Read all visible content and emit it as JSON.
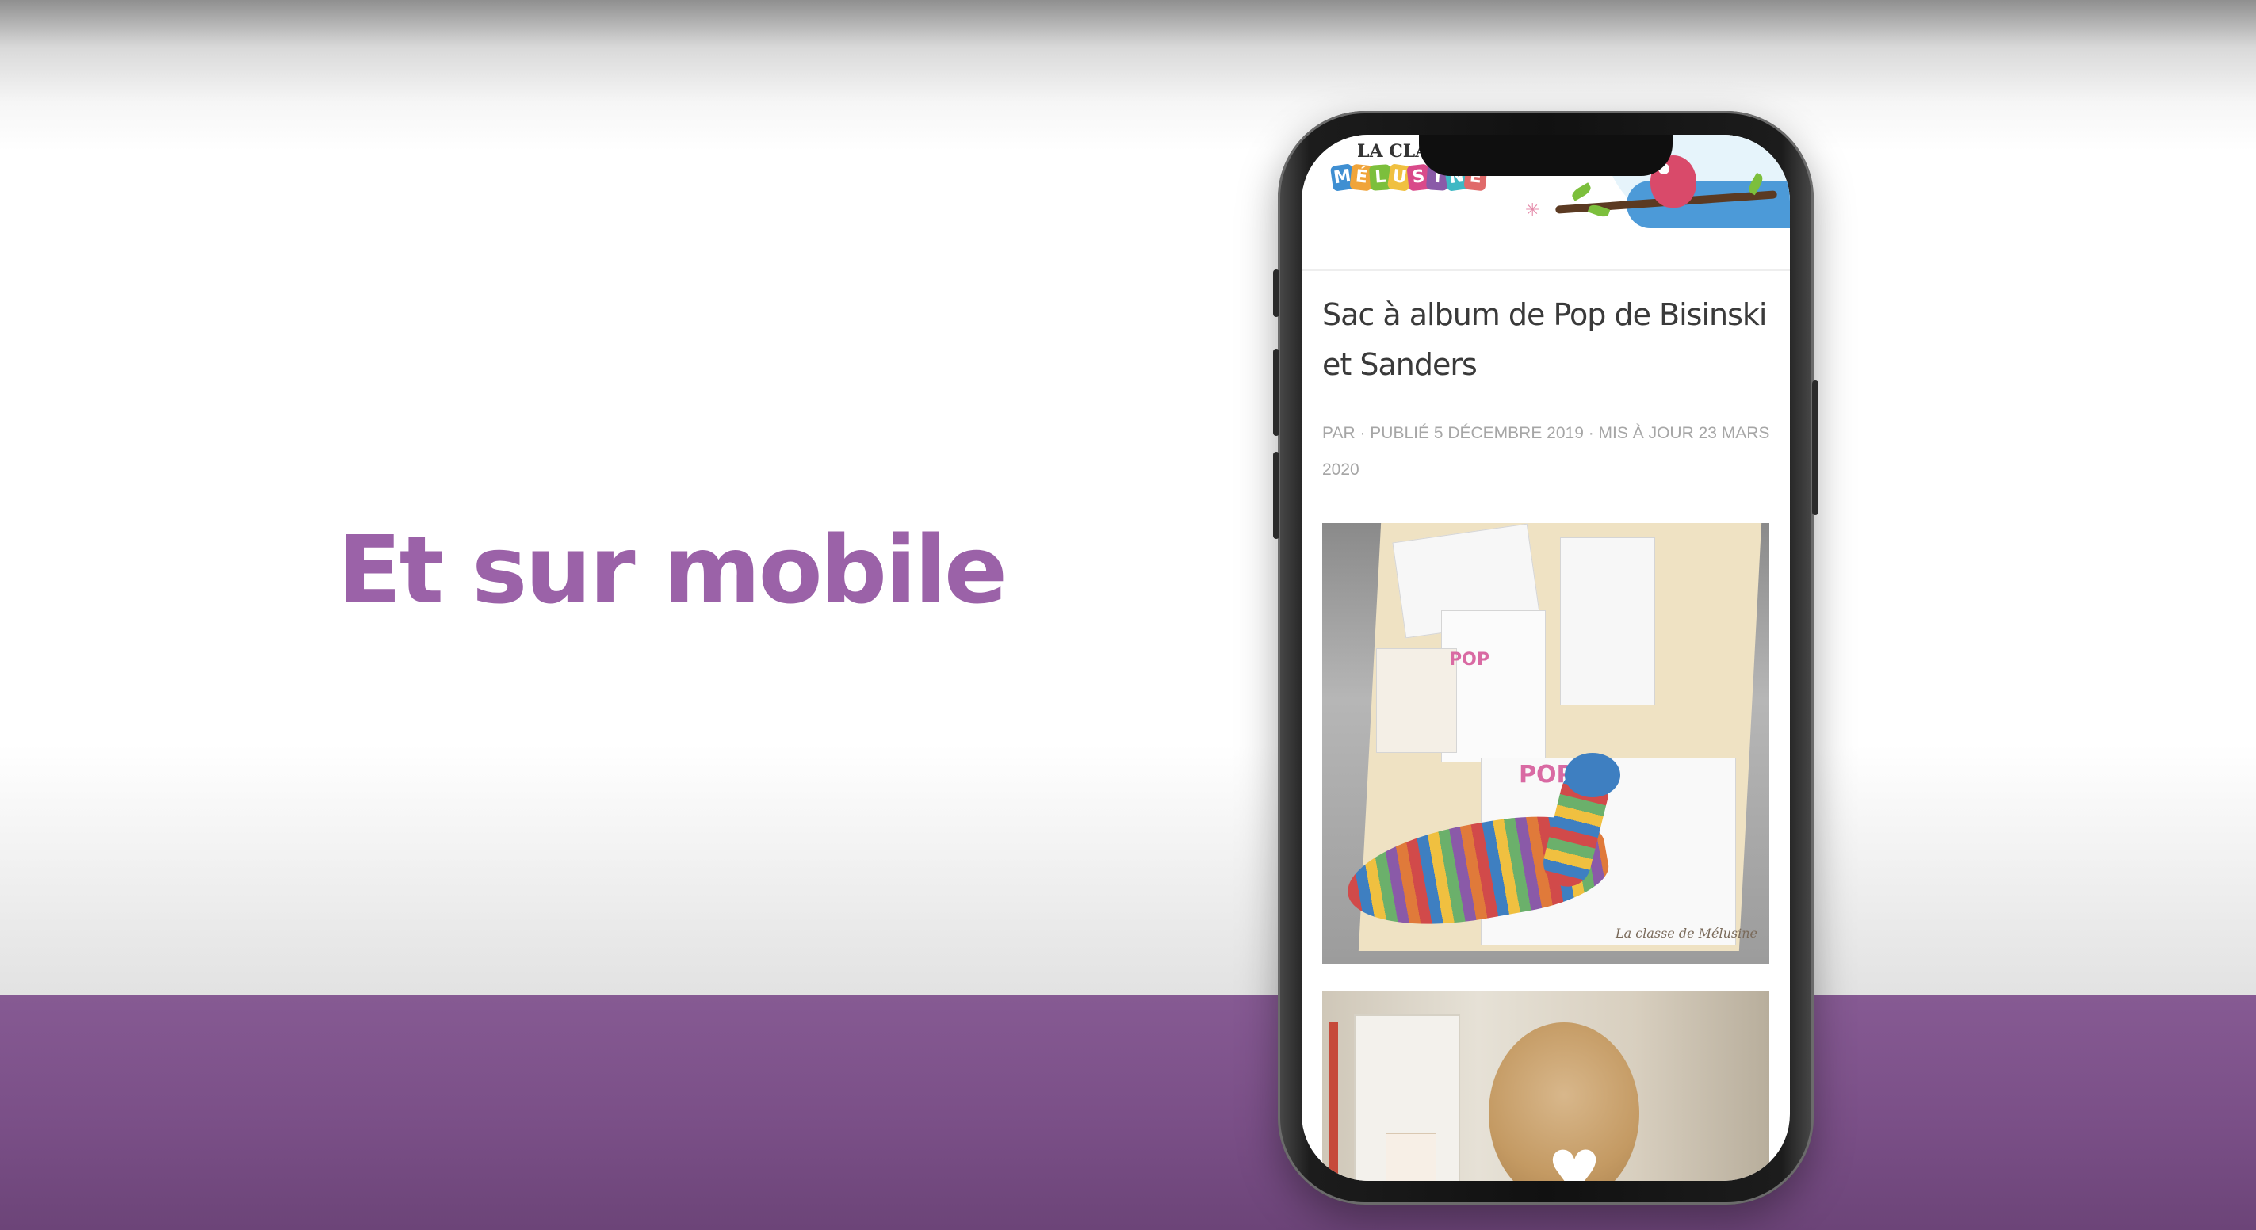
{
  "slide": {
    "headline": "Et sur mobile",
    "colors": {
      "headline": "#9b62a8",
      "band": "#7a4f87",
      "background": "#ffffff"
    }
  },
  "site": {
    "logo_line1": "LA CLASS",
    "logo_letters": [
      "M",
      "É",
      "L",
      "U",
      "S",
      "I",
      "N",
      "E"
    ],
    "logo_colors": [
      "#3f8fd2",
      "#f0a43a",
      "#7cbf3c",
      "#f0c040",
      "#d94a8a",
      "#8a5aa8",
      "#3fb8c4",
      "#e06a6a"
    ]
  },
  "post": {
    "title": "Sac à album de Pop de Bisinski et Sanders",
    "meta": "PAR · PUBLIÉ 5 DÉCEMBRE 2019 · MIS À JOUR 23 MARS 2020"
  },
  "photo1": {
    "text_pop_small": "POP",
    "text_pop_large": "POP",
    "signature": "La classe de Mélusine"
  },
  "icons": {
    "heart": "heart-icon"
  }
}
